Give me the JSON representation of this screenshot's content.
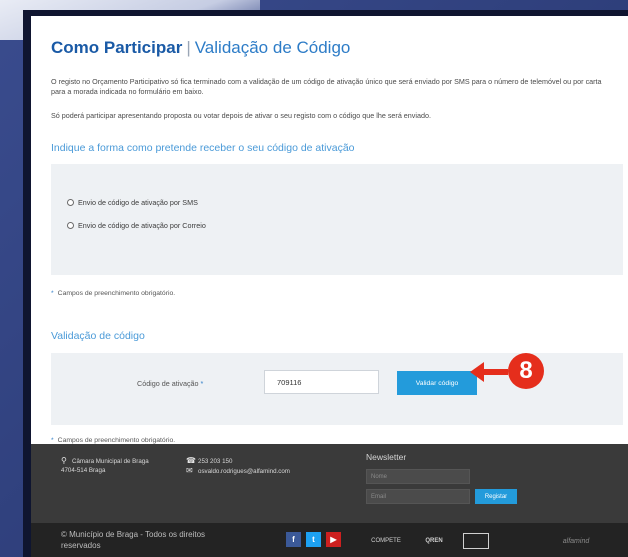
{
  "page": {
    "title_strong": "Como Participar",
    "title_separator": "|",
    "title_sub": "Validação de Código",
    "intro_text": "O registo no Orçamento Participativo só fica terminado com a validação de um código de ativação único que será enviado por SMS para o número de telemóvel ou por carta para a morada indicada no formulário em baixo.",
    "intro_text_2": "Só poderá participar apresentando proposta ou votar depois de ativar o seu registo com o código que lhe será enviado."
  },
  "method_section": {
    "heading": "Indique a forma como pretende receber o seu código de ativação",
    "options": [
      {
        "label": "Envio de código de ativação por SMS"
      },
      {
        "label": "Envio de código de ativação por Correio"
      }
    ],
    "required_note": "Campos de preenchimento obrigatório."
  },
  "validation_section": {
    "heading": "Validação de código",
    "code_label": "Código de ativação",
    "required_marker": "*",
    "code_value": "709116",
    "validate_button": "Validar código",
    "required_note": "Campos de preenchimento obrigatório."
  },
  "annotation": {
    "step_number": "8",
    "arrow_color": "#e52e1c"
  },
  "footer": {
    "address_line1": "Câmara Municipal de Braga",
    "address_line2": "4704-514 Braga",
    "phone": "253 203 150",
    "email": "osvaldo.rodrigues@alfamind.com",
    "newsletter_title": "Newsletter",
    "newsletter_name_placeholder": "Nome",
    "newsletter_email_placeholder": "Email",
    "newsletter_button": "Registar",
    "copyright": "© Município de Braga - Todos os direitos reservados",
    "social": [
      {
        "icon": "facebook-icon",
        "glyph": "f",
        "color": "#3b5998"
      },
      {
        "icon": "twitter-icon",
        "glyph": "t",
        "color": "#1da1f2"
      },
      {
        "icon": "youtube-icon",
        "glyph": "▶",
        "color": "#cd201f"
      }
    ],
    "partner_logos": [
      "COMPETE",
      "QREN",
      "",
      "alfamind"
    ]
  }
}
